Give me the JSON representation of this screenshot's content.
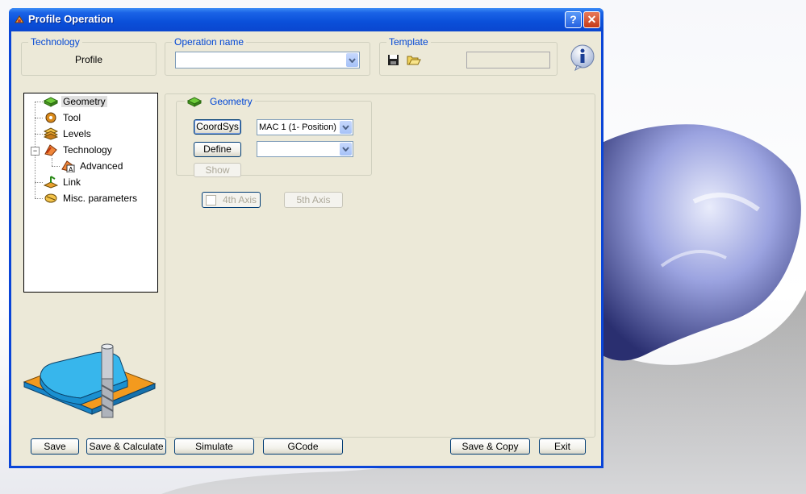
{
  "window": {
    "title": "Profile Operation"
  },
  "technology": {
    "label": "Technology",
    "value": "Profile"
  },
  "operation_name": {
    "label": "Operation name",
    "value": ""
  },
  "template": {
    "label": "Template",
    "value": ""
  },
  "tree": {
    "items": [
      {
        "label": "Geometry",
        "icon": "geometry-icon",
        "selected": true
      },
      {
        "label": "Tool",
        "icon": "tool-icon"
      },
      {
        "label": "Levels",
        "icon": "levels-icon"
      },
      {
        "label": "Technology",
        "icon": "technology-icon",
        "expanded": true
      },
      {
        "label": "Advanced",
        "icon": "advanced-icon"
      },
      {
        "label": "Link",
        "icon": "link-icon"
      },
      {
        "label": "Misc. parameters",
        "icon": "misc-parameters-icon"
      }
    ]
  },
  "geometry": {
    "label": "Geometry",
    "coordsys_button": "CoordSys",
    "coordsys_value": "MAC 1 (1- Position)",
    "define_button": "Define",
    "define_value": "",
    "show_button": "Show"
  },
  "axis": {
    "fourth": "4th Axis",
    "fifth": "5th Axis"
  },
  "footer": {
    "save": "Save",
    "save_calculate": "Save & Calculate",
    "simulate": "Simulate",
    "gcode": "GCode",
    "save_copy": "Save & Copy",
    "exit": "Exit"
  },
  "colors": {
    "title_bar": "#0a4fd9",
    "dialog_bg": "#ece9d8",
    "group_label": "#0046d5"
  }
}
